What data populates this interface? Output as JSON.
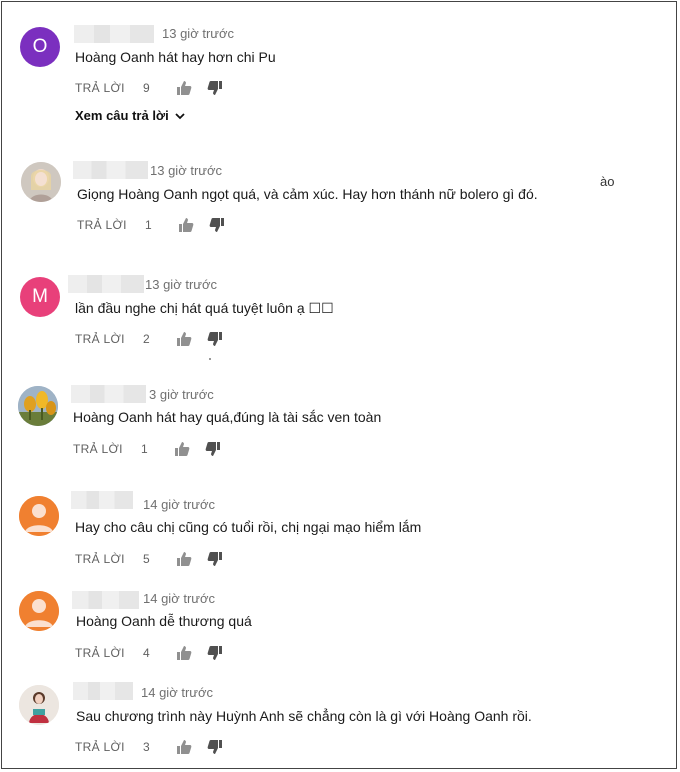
{
  "reply_label": "TRẢ LỜI",
  "view_replies_label": "Xem câu trả lời",
  "stray_text": "ào",
  "colors": {
    "avatar_purple": "#7b2fbf",
    "avatar_pink": "#e8407a",
    "avatar_orange": "#f08030"
  },
  "comments": [
    {
      "avatar": "O",
      "avatar_kind": "letter-purple",
      "time": "13 giờ trước",
      "text": "Hoàng Oanh hát hay hơn chi Pu",
      "likes": "9"
    },
    {
      "avatar": "",
      "avatar_kind": "photo-girl",
      "time": "13 giờ trước",
      "text": "Giọng Hoàng Oanh ngọt quá, và cảm xúc. Hay hơn thánh nữ bolero gì đó.",
      "likes": "1"
    },
    {
      "avatar": "M",
      "avatar_kind": "letter-pink",
      "time": "13 giờ trước",
      "text": "lần đầu nghe chị hát quá tuyệt luôn ạ ☐☐",
      "likes": "2"
    },
    {
      "avatar": "",
      "avatar_kind": "photo-flowers",
      "time": "3 giờ trước",
      "text": "Hoàng Oanh hát hay quá,đúng là tài sắc ven toàn",
      "likes": "1"
    },
    {
      "avatar": "",
      "avatar_kind": "default-orange",
      "time": "14 giờ trước",
      "text": "Hay cho câu chị cũng có tuổi rồi, chị ngại mạo hiểm lắm",
      "likes": "5"
    },
    {
      "avatar": "",
      "avatar_kind": "default-orange",
      "time": "14 giờ trước",
      "text": "Hoàng Oanh dễ thương quá",
      "likes": "4"
    },
    {
      "avatar": "",
      "avatar_kind": "photo-person",
      "time": "14 giờ trước",
      "text": "Sau chương trình này Huỳnh Anh sẽ chẳng còn là gì với Hoàng Oanh rồi.",
      "likes": "3"
    }
  ]
}
